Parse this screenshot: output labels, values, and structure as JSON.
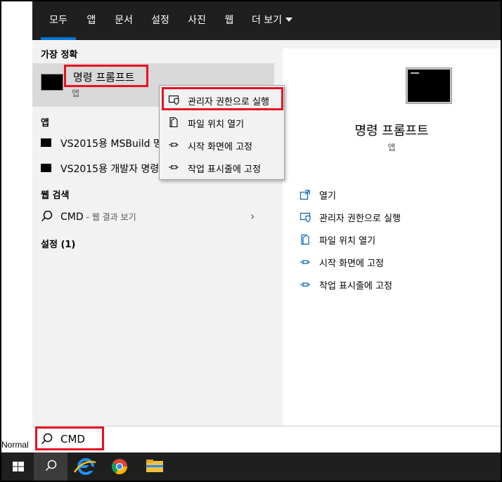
{
  "background": {
    "text": "Normal"
  },
  "nav": {
    "tabs": [
      {
        "label": "모두"
      },
      {
        "label": "앱"
      },
      {
        "label": "문서"
      },
      {
        "label": "설정"
      },
      {
        "label": "사진"
      },
      {
        "label": "웹"
      },
      {
        "label": "더 보기"
      }
    ]
  },
  "left": {
    "best_match_header": "가장 정확",
    "best_match": {
      "title": "명령 프롬프트",
      "subtitle": "앱"
    },
    "apps_header": "앱",
    "apps": [
      {
        "label": "VS2015용 MSBuild 명"
      },
      {
        "label": "VS2015용 개발자 명령"
      }
    ],
    "web_header": "웹 검색",
    "web": {
      "query": "CMD",
      "hint": "- 웹 결과 보기"
    },
    "settings_header": "설정 (1)"
  },
  "context_menu": {
    "items": [
      {
        "label": "관리자 권한으로 실행",
        "icon": "shield-icon"
      },
      {
        "label": "파일 위치 열기",
        "icon": "file-icon"
      },
      {
        "label": "시작 화면에 고정",
        "icon": "pin-icon"
      },
      {
        "label": "작업 표시줄에 고정",
        "icon": "pin-icon"
      }
    ]
  },
  "right": {
    "title": "명령 프롬프트",
    "subtitle": "앱",
    "actions": [
      {
        "label": "열기",
        "icon": "open-icon"
      },
      {
        "label": "관리자 권한으로 실행",
        "icon": "shield-icon"
      },
      {
        "label": "파일 위치 열기",
        "icon": "file-icon"
      },
      {
        "label": "시작 화면에 고정",
        "icon": "pin-icon"
      },
      {
        "label": "작업 표시줄에 고정",
        "icon": "pin-icon"
      }
    ]
  },
  "search": {
    "value": "CMD"
  },
  "taskbar": {
    "items": [
      "windows-logo-icon",
      "search-icon",
      "edge-icon",
      "chrome-icon",
      "file-explorer-icon"
    ]
  },
  "colors": {
    "accent": "#0078d7",
    "highlight": "#e81123",
    "nav_bg": "#1f1f1f"
  }
}
